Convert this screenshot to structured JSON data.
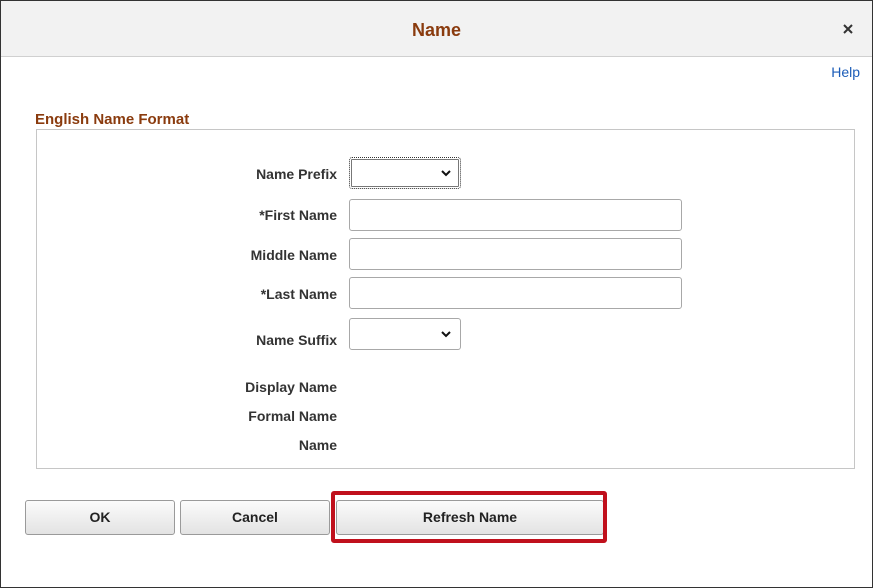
{
  "dialog": {
    "title": "Name",
    "close_icon": "close-icon",
    "help_label": "Help"
  },
  "section": {
    "title": "English Name Format"
  },
  "fields": {
    "name_prefix": {
      "label": "Name Prefix",
      "value": ""
    },
    "first_name": {
      "label": "*First Name",
      "value": ""
    },
    "middle_name": {
      "label": "Middle Name",
      "value": ""
    },
    "last_name": {
      "label": "*Last Name",
      "value": ""
    },
    "name_suffix": {
      "label": "Name Suffix",
      "value": ""
    },
    "display_name": {
      "label": "Display Name",
      "value": ""
    },
    "formal_name": {
      "label": "Formal Name",
      "value": ""
    },
    "name": {
      "label": "Name",
      "value": ""
    }
  },
  "buttons": {
    "ok": "OK",
    "cancel": "Cancel",
    "refresh_name": "Refresh Name"
  },
  "colors": {
    "title": "#8a3b0e",
    "link": "#1b5cb8",
    "highlight": "#c0101c"
  }
}
